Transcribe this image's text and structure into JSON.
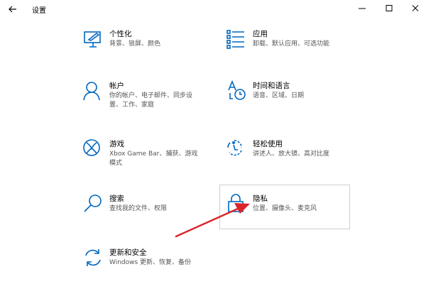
{
  "window": {
    "title": "设置"
  },
  "items": [
    {
      "label": "个性化",
      "desc": "背景、锁屏、颜色",
      "icon": "personalization-icon"
    },
    {
      "label": "应用",
      "desc": "卸载、默认应用、可选功能",
      "icon": "apps-icon"
    },
    {
      "label": "帐户",
      "desc": "你的帐户、电子邮件、同步设置、工作、家庭",
      "icon": "account-icon"
    },
    {
      "label": "时间和语言",
      "desc": "语音、区域、日期",
      "icon": "time-language-icon"
    },
    {
      "label": "游戏",
      "desc": "Xbox Game Bar、捕获、游戏模式",
      "icon": "gaming-icon"
    },
    {
      "label": "轻松使用",
      "desc": "讲述人、放大镜、高对比度",
      "icon": "ease-of-access-icon"
    },
    {
      "label": "搜索",
      "desc": "查找我的文件、权限",
      "icon": "search-icon"
    },
    {
      "label": "隐私",
      "desc": "位置、摄像头、麦克风",
      "icon": "privacy-lock-icon"
    },
    {
      "label": "更新和安全",
      "desc": "Windows 更新、恢复、备份",
      "icon": "update-security-icon"
    }
  ],
  "colors": {
    "accent": "#0067c0",
    "arrow": "#d9252b"
  }
}
